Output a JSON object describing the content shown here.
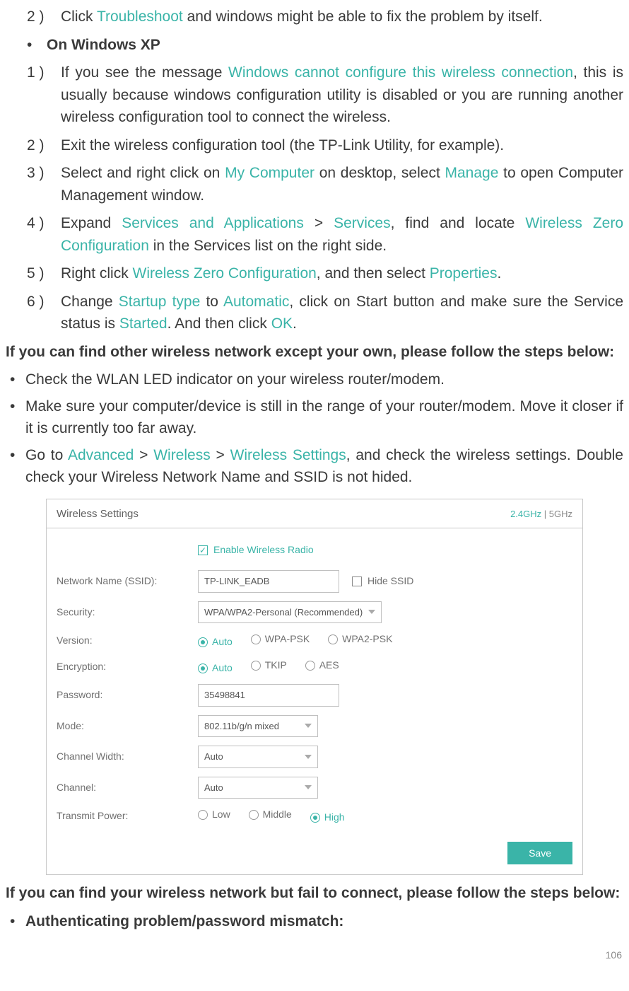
{
  "steps_top": {
    "s2_pre": "Click ",
    "s2_link": "Troubleshoot",
    "s2_post": " and windows might be able to fix the problem by itself."
  },
  "xp_heading": "On Windows XP",
  "xp": {
    "s1_pre": "If you see the message ",
    "s1_link": "Windows cannot configure this wireless connection",
    "s1_post": ", this is usually because windows configuration utility is disabled or you are running another wireless configuration tool to connect the wireless.",
    "s2": "Exit the wireless configuration tool (the TP-Link Utility, for example).",
    "s3_a": "Select and right click on ",
    "s3_link1": "My Computer",
    "s3_b": " on desktop, select ",
    "s3_link2": "Manage",
    "s3_c": " to open Computer Management window.",
    "s4_a": "Expand ",
    "s4_link1": "Services and Applications",
    "s4_b": " > ",
    "s4_link2": "Services",
    "s4_c": ", find and locate ",
    "s4_link3": "Wireless Zero Configuration",
    "s4_d": " in the Services list on the right side.",
    "s5_a": "Right click ",
    "s5_link1": "Wireless Zero Configuration",
    "s5_b": ", and then select ",
    "s5_link2": "Properties",
    "s5_c": ".",
    "s6_a": "Change ",
    "s6_link1": "Startup type",
    "s6_b": " to ",
    "s6_link2": "Automatic",
    "s6_c": ", click on Start button and make sure the Service status is ",
    "s6_link3": "Started",
    "s6_d": ". And then click ",
    "s6_link4": "OK",
    "s6_e": "."
  },
  "heading_other": "If you can find other wireless network except your own, please follow the steps below:",
  "bullets": {
    "b1": "Check the WLAN LED indicator on your wireless router/modem.",
    "b2": "Make sure your computer/device is still in the range of your router/modem. Move it closer if it is currently too far away.",
    "b3_a": "Go to ",
    "b3_link1": "Advanced",
    "b3_b": " > ",
    "b3_link2": "Wireless",
    "b3_c": " > ",
    "b3_link3": "Wireless Settings",
    "b3_d": ", and check the wireless settings. Double check your Wireless Network Name and SSID is not hided."
  },
  "panel": {
    "title": "Wireless Settings",
    "band_24": "2.4GHz",
    "band_sep": "  |  ",
    "band_5": "5GHz",
    "enable_label": "Enable Wireless Radio",
    "labels": {
      "ssid": "Network Name (SSID):",
      "security": "Security:",
      "version": "Version:",
      "encryption": "Encryption:",
      "password": "Password:",
      "mode": "Mode:",
      "channel_width": "Channel Width:",
      "channel": "Channel:",
      "transmit": "Transmit Power:"
    },
    "values": {
      "ssid": "TP-LINK_EADB",
      "hide_ssid": "Hide SSID",
      "security": "WPA/WPA2-Personal (Recommended)",
      "version_opts": [
        "Auto",
        "WPA-PSK",
        "WPA2-PSK"
      ],
      "encryption_opts": [
        "Auto",
        "TKIP",
        "AES"
      ],
      "password": "35498841",
      "mode": "802.11b/g/n mixed",
      "channel_width": "Auto",
      "channel": "Auto",
      "transmit_opts": [
        "Low",
        "Middle",
        "High"
      ]
    },
    "save": "Save"
  },
  "heading_fail": "If you can find your wireless network but fail to connect, please follow the steps below:",
  "auth_bullet": "Authenticating problem/password mismatch:",
  "page_number": "106",
  "nums": {
    "n1": "1 )",
    "n2": "2 )",
    "n3": "3 )",
    "n4": "4 )",
    "n5": "5 )",
    "n6": "6 )"
  },
  "bullet_char": "•"
}
